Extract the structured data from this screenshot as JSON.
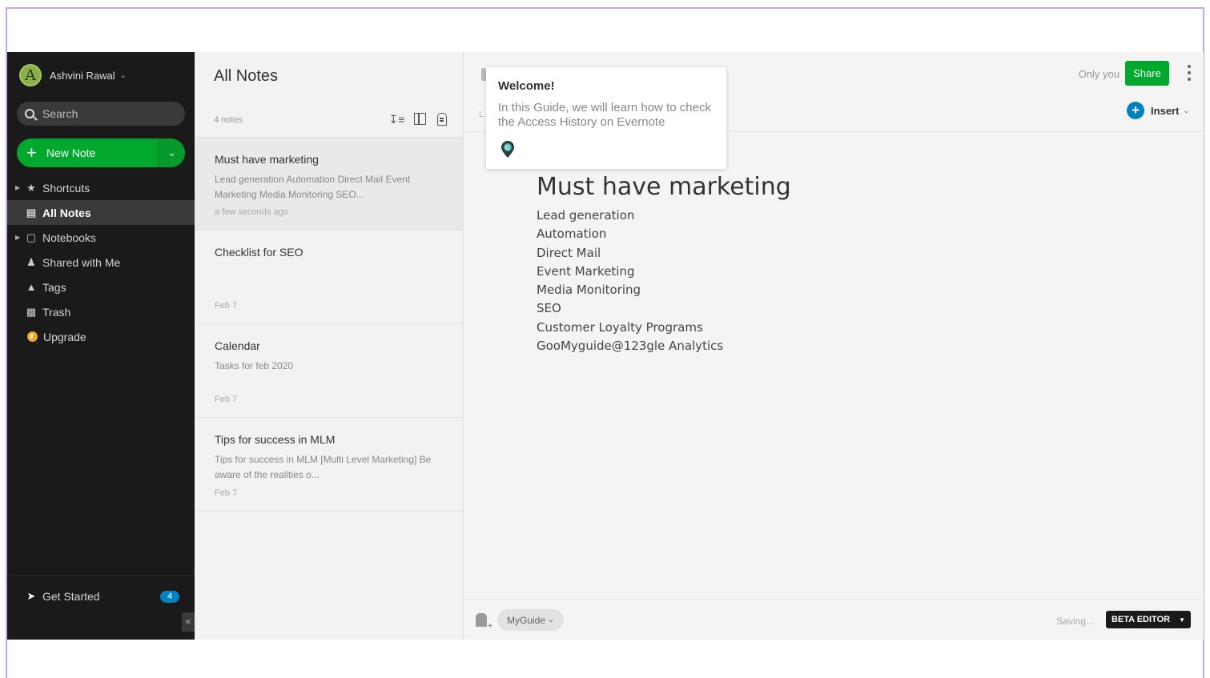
{
  "account": {
    "initial": "A",
    "name": "Ashvini Rawal"
  },
  "search": {
    "placeholder": "Search"
  },
  "new_note": {
    "label": "New Note"
  },
  "nav": {
    "shortcuts": "Shortcuts",
    "all_notes": "All Notes",
    "notebooks": "Notebooks",
    "shared": "Shared with Me",
    "tags": "Tags",
    "trash": "Trash",
    "upgrade": "Upgrade"
  },
  "get_started": {
    "label": "Get Started",
    "count": "4"
  },
  "note_list": {
    "title": "All Notes",
    "count": "4 notes",
    "notes": [
      {
        "title": "Must have marketing",
        "snippet": "Lead generation Automation Direct Mail Event Marketing Media Monitoring SEO...",
        "date": "a few seconds ago"
      },
      {
        "title": "Checklist for SEO",
        "snippet": "",
        "date": "Feb 7"
      },
      {
        "title": "Calendar",
        "snippet": "Tasks for feb 2020",
        "date": "Feb 7"
      },
      {
        "title": "Tips for success in MLM",
        "snippet": "Tips for success in MLM [Multi Level Marketing] Be aware of the realities o...",
        "date": "Feb 7"
      }
    ]
  },
  "editor": {
    "sharing": "Only you",
    "share_label": "Share",
    "insert_label": "Insert",
    "sub_letter": "L",
    "heading": "Must have marketing",
    "lines": [
      "Lead generation",
      "Automation",
      "Direct Mail",
      "Event Marketing",
      "Media Monitoring",
      "SEO",
      "Customer Loyalty Programs",
      "GooMyguide@123gle Analytics"
    ],
    "tag": "MyGuide",
    "status": "Saving...",
    "beta_label": "BETA EDITOR"
  },
  "popup": {
    "title": "Welcome!",
    "text": "In this Guide, we will learn how to check the Access History on Evernote",
    "logo_letter": "G"
  },
  "colors": {
    "brand_green": "#00a82d",
    "accent_blue": "#0081c2",
    "sidebar_bg": "#1a1a1a",
    "frame_border": "#c9a8e8"
  }
}
